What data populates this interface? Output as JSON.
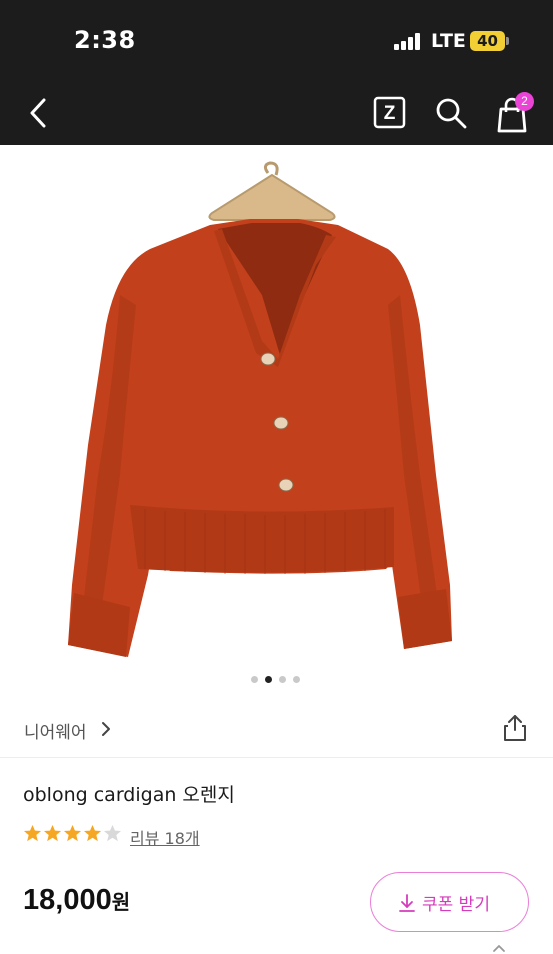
{
  "status_bar": {
    "time": "2:38",
    "network": "LTE",
    "battery": "40"
  },
  "nav": {
    "back_icon": "chevron-left-icon",
    "z_icon": "z-box-icon",
    "z_label": "Z",
    "search_icon": "search-icon",
    "cart_icon": "shopping-bag-icon",
    "cart_count": "2"
  },
  "product": {
    "image_description": "orange cardigan on wooden hanger",
    "carousel": {
      "total": 4,
      "active_index": 1
    },
    "brand": "니어웨어",
    "name": "oblong cardigan 오렌지",
    "rating": {
      "stars": 4,
      "max": 5
    },
    "review_label": "리뷰 18개",
    "price": "18,000",
    "price_unit": "원",
    "coupon_label": "쿠폰 받기"
  },
  "colors": {
    "status_bg": "#1c1c1c",
    "accent_pink": "#ea43d6",
    "coupon_text": "#d63bbd",
    "star": "#f5a623",
    "star_empty": "#d9d9d9",
    "cardigan": "#c2401b"
  }
}
